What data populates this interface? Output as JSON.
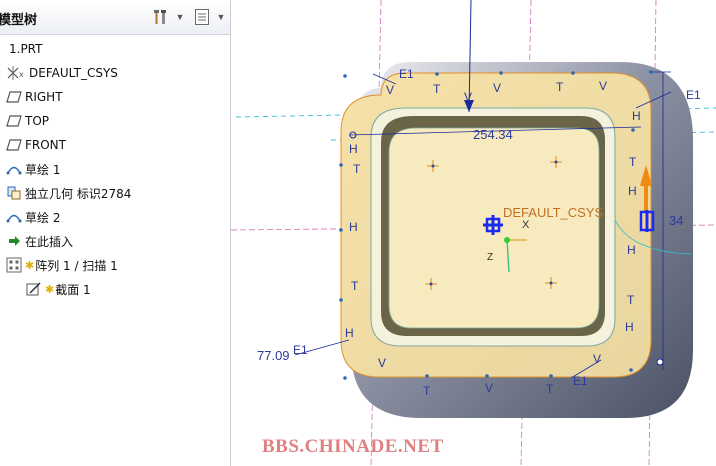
{
  "panel": {
    "title": "模型树",
    "toolbar": {
      "settings_icon": "tools-icon",
      "show_icon": "list-icon"
    }
  },
  "tree": {
    "items": [
      {
        "label": "1.PRT",
        "icon": "part-icon"
      },
      {
        "label": "DEFAULT_CSYS",
        "icon": "csys-icon"
      },
      {
        "label": "RIGHT",
        "icon": "datum-plane-icon"
      },
      {
        "label": "TOP",
        "icon": "datum-plane-icon"
      },
      {
        "label": "FRONT",
        "icon": "datum-plane-icon"
      },
      {
        "label": "草绘 1",
        "icon": "sketch-icon"
      },
      {
        "label": "独立几何 标识2784",
        "icon": "independent-geometry-icon"
      },
      {
        "label": "草绘 2",
        "icon": "sketch-icon"
      },
      {
        "label": "在此插入",
        "icon": "insert-here-arrow-icon"
      },
      {
        "label": "阵列 1 / 扫描 1",
        "icon": "pattern-icon"
      },
      {
        "label": "截面 1",
        "icon": "section-icon"
      }
    ]
  },
  "viewport": {
    "csys_label": "DEFAULT_CSYS",
    "axis_x": "X",
    "axis_z": "Z",
    "dim_width": "254.34",
    "dim_angle": "77.09",
    "dim_right": "34",
    "edge_label_e1": "E1",
    "constraint_t": "T",
    "constraint_h": "H",
    "constraint_v": "V",
    "watermark": "BBS.CHINADE.NET",
    "colors": {
      "accent_blue": "#1a2a9a",
      "body_fill": "#f7e9bd",
      "shadow": "#6c7286",
      "cyan_guide": "#33bbcc",
      "pink_guide": "#d070b0",
      "drag_arrow": "#f08a10"
    }
  }
}
